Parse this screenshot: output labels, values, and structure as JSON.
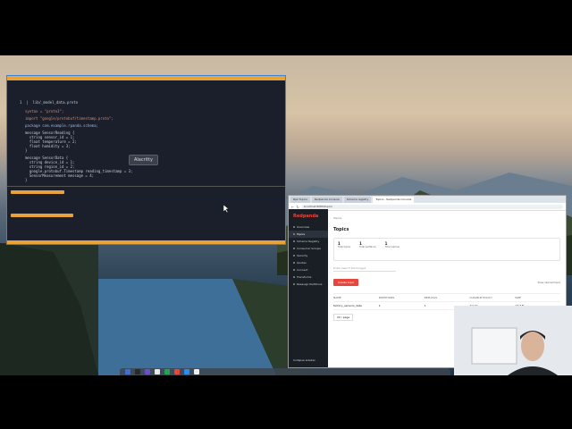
{
  "terminal": {
    "tooltip": "Alacritty",
    "code_header": "1  |  lib/_model_data.proto",
    "lines": [
      "syntax = \"proto3\";",
      "import \"google/protobuf/timestamp.proto\";",
      "package com.example.rpanda.schema;",
      "message SensorReading {",
      "  string sensor_id = 1;",
      "  float temperature = 2;",
      "  float humidity = 3;",
      "}",
      "message SensorData {",
      "  string device_id = 1;",
      "  string region_id = 2;",
      "  google.protobuf.Timestamp reading_timestamp = 3;",
      "  SensorMeasurement message = 4;",
      "}"
    ]
  },
  "browser": {
    "tabs": [
      "Rpk Topics",
      "Redpanda Console",
      "Schema registry",
      "Topics - Redpanda Console"
    ],
    "address": "localhost:8080/topics",
    "brand": "Redpanda",
    "nav": [
      "Overview",
      "Topics",
      "Schema Registry",
      "Consumer Groups",
      "Security",
      "Quotas",
      "Connect",
      "Transforms",
      "Reassign Partitions"
    ],
    "footer_nav": "Collapse sidebar",
    "breadcrumb": "Topics",
    "page_title": "Topics",
    "stats": [
      {
        "value": "1",
        "label": "Total topics"
      },
      {
        "value": "1",
        "label": "Total partitions"
      },
      {
        "value": "1",
        "label": "Total replicas"
      }
    ],
    "search_placeholder": "Enter search term/regex",
    "create_button": "Create topic",
    "internal_toggle": "Show internal topics",
    "table_headers": [
      "NAME",
      "PARTITIONS",
      "REPLICAS",
      "CLEANUP POLICY",
      "SIZE"
    ],
    "table_row": [
      "factory_sensors_data",
      "1",
      "1",
      "delete",
      "17.7 B"
    ],
    "page_size": "20 / page",
    "page_number": "1"
  }
}
